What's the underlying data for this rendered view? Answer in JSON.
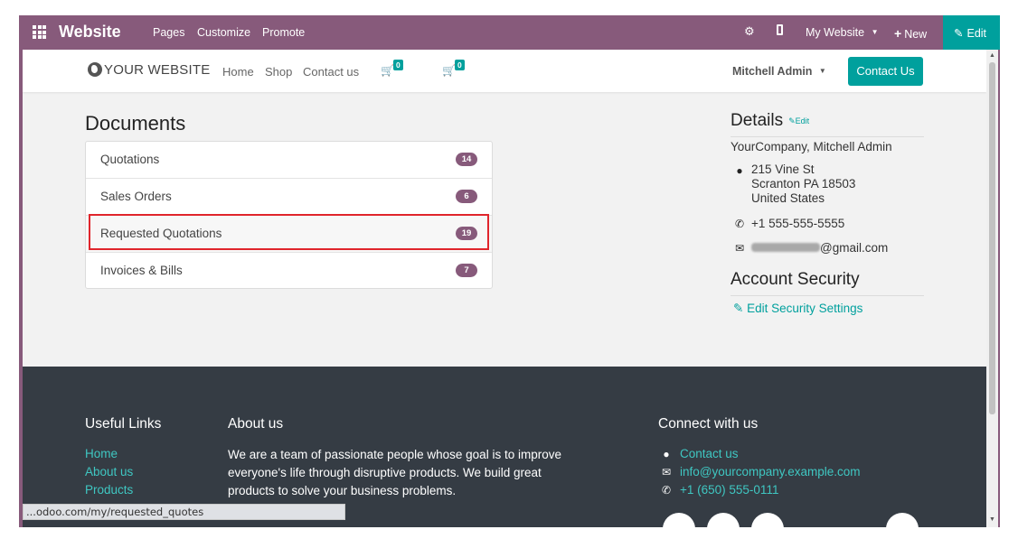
{
  "adminbar": {
    "brand": "Website",
    "menu": [
      "Pages",
      "Customize",
      "Promote"
    ],
    "website_selector": "My Website",
    "new_label": "New",
    "edit_label": "Edit"
  },
  "navbar": {
    "logo_text": "YOUR WEBSITE",
    "links": [
      "Home",
      "Shop",
      "Contact us"
    ],
    "cart_counts": [
      "0",
      "0"
    ],
    "user_name": "Mitchell Admin",
    "contact_button": "Contact Us"
  },
  "documents": {
    "title": "Documents",
    "items": [
      {
        "label": "Quotations",
        "count": "14"
      },
      {
        "label": "Sales Orders",
        "count": "6"
      },
      {
        "label": "Requested Quotations",
        "count": "19"
      },
      {
        "label": "Invoices & Bills",
        "count": "7"
      }
    ]
  },
  "details": {
    "title": "Details",
    "edit_label": "Edit",
    "company": "YourCompany, Mitchell Admin",
    "address_line1": "215 Vine St",
    "address_line2": "Scranton PA 18503",
    "address_line3": "United States",
    "phone": "+1 555-555-5555",
    "email_suffix": "@gmail.com"
  },
  "security": {
    "title": "Account Security",
    "link_label": "Edit Security Settings"
  },
  "footer": {
    "useful_links_title": "Useful Links",
    "useful_links": [
      "Home",
      "About us",
      "Products"
    ],
    "about_title": "About us",
    "about_text": "We are a team of passionate people whose goal is to improve everyone's life through disruptive products. We build great products to solve your business problems.",
    "connect_title": "Connect with us",
    "connect_items": [
      "Contact us",
      "info@yourcompany.example.com",
      "+1 (650) 555-0111"
    ]
  },
  "status_url": "...odoo.com/my/requested_quotes",
  "colors": {
    "primary": "#875a7b",
    "accent": "#00a09d",
    "footer_bg": "#353c44",
    "highlight_border": "#e0252c"
  }
}
